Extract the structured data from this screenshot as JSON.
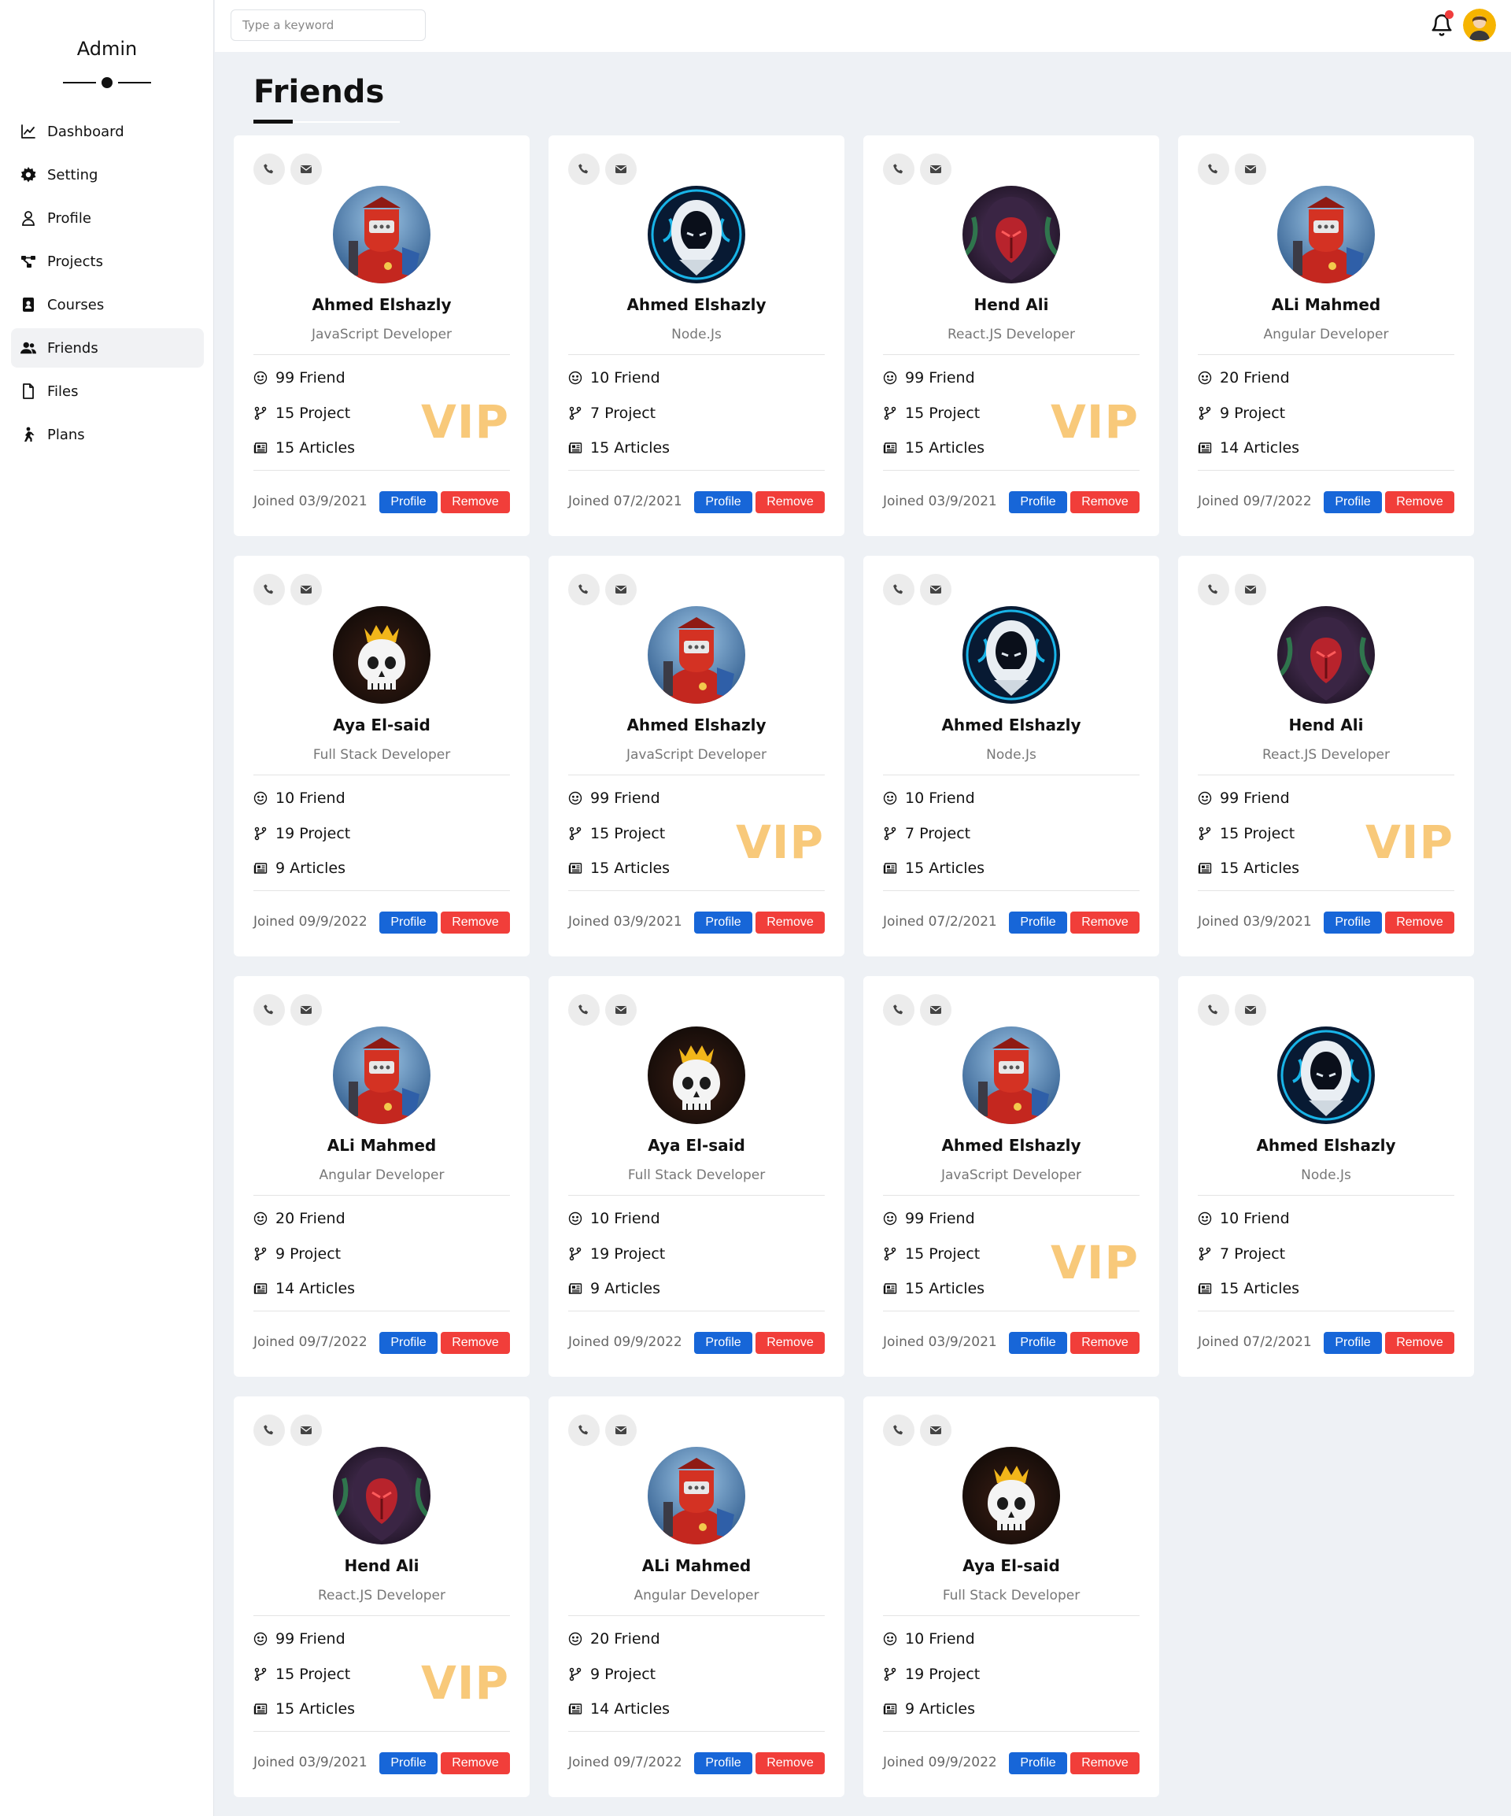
{
  "sidebar": {
    "brand": "Admin",
    "items": [
      {
        "label": "Dashboard",
        "icon": "chart-line-icon"
      },
      {
        "label": "Setting",
        "icon": "gear-icon"
      },
      {
        "label": "Profile",
        "icon": "user-icon"
      },
      {
        "label": "Projects",
        "icon": "diagram-project-icon"
      },
      {
        "label": "Courses",
        "icon": "address-book-icon"
      },
      {
        "label": "Friends",
        "icon": "users-icon"
      },
      {
        "label": "Files",
        "icon": "file-icon"
      },
      {
        "label": "Plans",
        "icon": "hiking-icon"
      }
    ],
    "active_index": 5
  },
  "header": {
    "search_placeholder": "Type a keyword",
    "notification_badge_color": "#f03d3d"
  },
  "page": {
    "title": "Friends"
  },
  "colors": {
    "profile_button": "#1766d8",
    "remove_button": "#f13e3a",
    "vip": "#f8c97a"
  },
  "friends": [
    {
      "name": "Ahmed Elshazly",
      "role": "JavaScript Developer",
      "friends": "99 Friend",
      "projects": "15 Project",
      "articles": "15 Articles",
      "joined": "Joined 03/9/2021",
      "vip": "VIP",
      "avatar": "red-robot"
    },
    {
      "name": "Ahmed Elshazly",
      "role": "Node.Js",
      "friends": "10 Friend",
      "projects": "7 Project",
      "articles": "15 Articles",
      "joined": "Joined 07/2/2021",
      "vip": "",
      "avatar": "hooded-blue"
    },
    {
      "name": "Hend Ali",
      "role": "React.JS Developer",
      "friends": "99 Friend",
      "projects": "15 Project",
      "articles": "15 Articles",
      "joined": "Joined 03/9/2021",
      "vip": "VIP",
      "avatar": "hooded-red"
    },
    {
      "name": "ALi Mahmed",
      "role": "Angular Developer",
      "friends": "20 Friend",
      "projects": "9 Project",
      "articles": "14 Articles",
      "joined": "Joined 09/7/2022",
      "vip": "",
      "avatar": "red-robot"
    },
    {
      "name": "Aya El-said",
      "role": "Full Stack Developer",
      "friends": "10 Friend",
      "projects": "19 Project",
      "articles": "9 Articles",
      "joined": "Joined 09/9/2022",
      "vip": "",
      "avatar": "skull-crown"
    },
    {
      "name": "Ahmed Elshazly",
      "role": "JavaScript Developer",
      "friends": "99 Friend",
      "projects": "15 Project",
      "articles": "15 Articles",
      "joined": "Joined 03/9/2021",
      "vip": "VIP",
      "avatar": "red-robot"
    },
    {
      "name": "Ahmed Elshazly",
      "role": "Node.Js",
      "friends": "10 Friend",
      "projects": "7 Project",
      "articles": "15 Articles",
      "joined": "Joined 07/2/2021",
      "vip": "",
      "avatar": "hooded-blue"
    },
    {
      "name": "Hend Ali",
      "role": "React.JS Developer",
      "friends": "99 Friend",
      "projects": "15 Project",
      "articles": "15 Articles",
      "joined": "Joined 03/9/2021",
      "vip": "VIP",
      "avatar": "hooded-red"
    },
    {
      "name": "ALi Mahmed",
      "role": "Angular Developer",
      "friends": "20 Friend",
      "projects": "9 Project",
      "articles": "14 Articles",
      "joined": "Joined 09/7/2022",
      "vip": "",
      "avatar": "red-robot"
    },
    {
      "name": "Aya El-said",
      "role": "Full Stack Developer",
      "friends": "10 Friend",
      "projects": "19 Project",
      "articles": "9 Articles",
      "joined": "Joined 09/9/2022",
      "vip": "",
      "avatar": "skull-crown"
    },
    {
      "name": "Ahmed Elshazly",
      "role": "JavaScript Developer",
      "friends": "99 Friend",
      "projects": "15 Project",
      "articles": "15 Articles",
      "joined": "Joined 03/9/2021",
      "vip": "VIP",
      "avatar": "red-robot"
    },
    {
      "name": "Ahmed Elshazly",
      "role": "Node.Js",
      "friends": "10 Friend",
      "projects": "7 Project",
      "articles": "15 Articles",
      "joined": "Joined 07/2/2021",
      "vip": "",
      "avatar": "hooded-blue"
    },
    {
      "name": "Hend Ali",
      "role": "React.JS Developer",
      "friends": "99 Friend",
      "projects": "15 Project",
      "articles": "15 Articles",
      "joined": "Joined 03/9/2021",
      "vip": "VIP",
      "avatar": "hooded-red"
    },
    {
      "name": "ALi Mahmed",
      "role": "Angular Developer",
      "friends": "20 Friend",
      "projects": "9 Project",
      "articles": "14 Articles",
      "joined": "Joined 09/7/2022",
      "vip": "",
      "avatar": "red-robot"
    },
    {
      "name": "Aya El-said",
      "role": "Full Stack Developer",
      "friends": "10 Friend",
      "projects": "19 Project",
      "articles": "9 Articles",
      "joined": "Joined 09/9/2022",
      "vip": "",
      "avatar": "skull-crown"
    }
  ],
  "card_actions": {
    "profile": "Profile",
    "remove": "Remove"
  }
}
